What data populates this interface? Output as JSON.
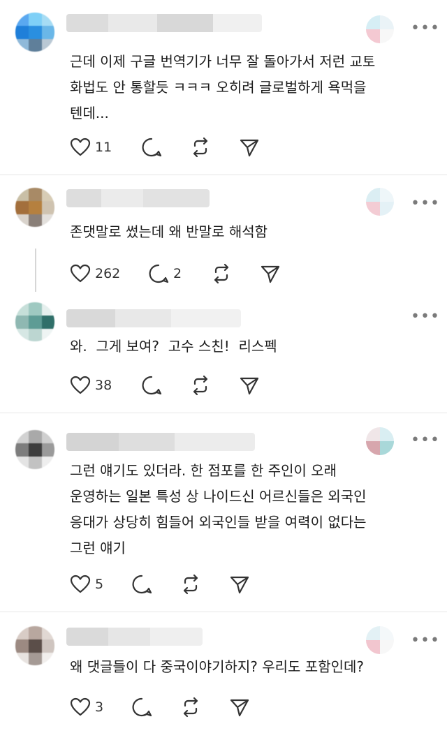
{
  "comments": [
    {
      "text": "근데 이제 구글 번역기가 너무 잘 돌아가서 저런 교토\n화법도 안 통할듯 ㅋㅋㅋ 오히려 글로벌하게 욕먹을\n텐데...",
      "likes": "11",
      "replies": ""
    },
    {
      "text": "존댓말로 썼는데 왜 반말로 해석함",
      "likes": "262",
      "replies": "2"
    },
    {
      "text": "와.  그게 보여?  고수 스친!  리스펙",
      "likes": "38",
      "replies": ""
    },
    {
      "text": "그런 얘기도 있더라. 한 점포를 한 주인이 오래\n운영하는 일본 특성 상 나이드신 어르신들은 외국인\n응대가 상당히 힘들어 외국인들 받을 여력이 없다는\n그런 얘기",
      "likes": "5",
      "replies": ""
    },
    {
      "text": "왜 댓글들이 다 중국이야기하지? 우리도 포함인데?",
      "likes": "3",
      "replies": ""
    }
  ],
  "icons": {
    "like": "heart-icon",
    "reply": "comment-bubble-icon",
    "repost": "repost-icon",
    "share": "send-icon",
    "more": "more-options-icon"
  },
  "more_glyph": "•••"
}
